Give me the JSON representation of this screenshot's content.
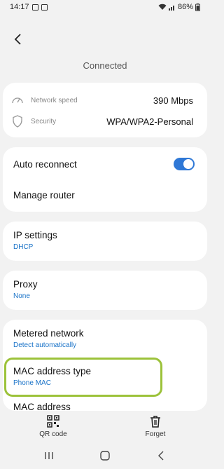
{
  "status_bar": {
    "time": "14:17",
    "battery": "86%"
  },
  "page": {
    "title": "Connected"
  },
  "info": [
    {
      "label": "Network speed",
      "value": "390 Mbps",
      "icon": "speedometer-icon"
    },
    {
      "label": "Security",
      "value": "WPA/WPA2-Personal",
      "icon": "shield-icon"
    }
  ],
  "settings": {
    "auto_reconnect": {
      "label": "Auto reconnect",
      "on": true
    },
    "manage_router": {
      "label": "Manage router"
    },
    "ip_settings": {
      "label": "IP settings",
      "value": "DHCP"
    },
    "proxy": {
      "label": "Proxy",
      "value": "None"
    },
    "metered": {
      "label": "Metered network",
      "value": "Detect automatically"
    },
    "mac_type": {
      "label": "MAC address type",
      "value": "Phone MAC"
    },
    "mac_address": {
      "label": "MAC address"
    }
  },
  "actions": {
    "qr": "QR code",
    "forget": "Forget"
  },
  "colors": {
    "accent": "#2f78d6",
    "link": "#1a73c8",
    "highlight": "#9cc23a"
  }
}
